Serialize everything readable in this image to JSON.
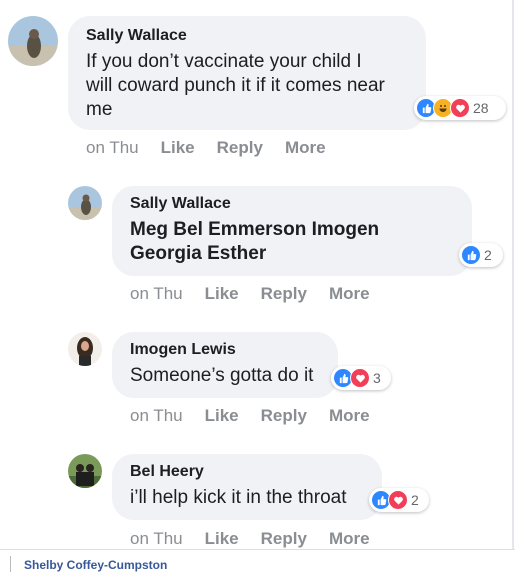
{
  "comments": [
    {
      "author": "Sally Wallace",
      "text": "If you don’t vaccinate your child I will coward punch it if it comes near me",
      "time": "on Thu",
      "like": "Like",
      "reply": "Reply",
      "more": "More",
      "reaction_count": "28",
      "reactions": [
        "like-icon",
        "haha-icon",
        "love-icon"
      ]
    },
    {
      "author": "Sally Wallace",
      "text": "Meg Bel Emmerson Imogen Georgia Esther",
      "time": "on Thu",
      "like": "Like",
      "reply": "Reply",
      "more": "More",
      "reaction_count": "2",
      "reactions": [
        "like-icon"
      ]
    },
    {
      "author": "Imogen Lewis",
      "text": "Someone’s gotta do it",
      "time": "on Thu",
      "like": "Like",
      "reply": "Reply",
      "more": "More",
      "reaction_count": "3",
      "reactions": [
        "like-icon",
        "love-icon"
      ]
    },
    {
      "author": "Bel Heery",
      "text": "i’ll help kick it in the throat",
      "time": "on Thu",
      "like": "Like",
      "reply": "Reply",
      "more": "More",
      "reaction_count": "2",
      "reactions": [
        "like-icon",
        "love-icon"
      ]
    }
  ],
  "footer": {
    "name": "Shelby Coffey-Cumpston"
  },
  "colors": {
    "bubble": "#f0f2f5",
    "action_text": "#8a8d91",
    "like_blue": "#2d88ff",
    "love_red": "#f33e58",
    "haha_yellow": "#f7b125",
    "link_blue": "#385898"
  }
}
